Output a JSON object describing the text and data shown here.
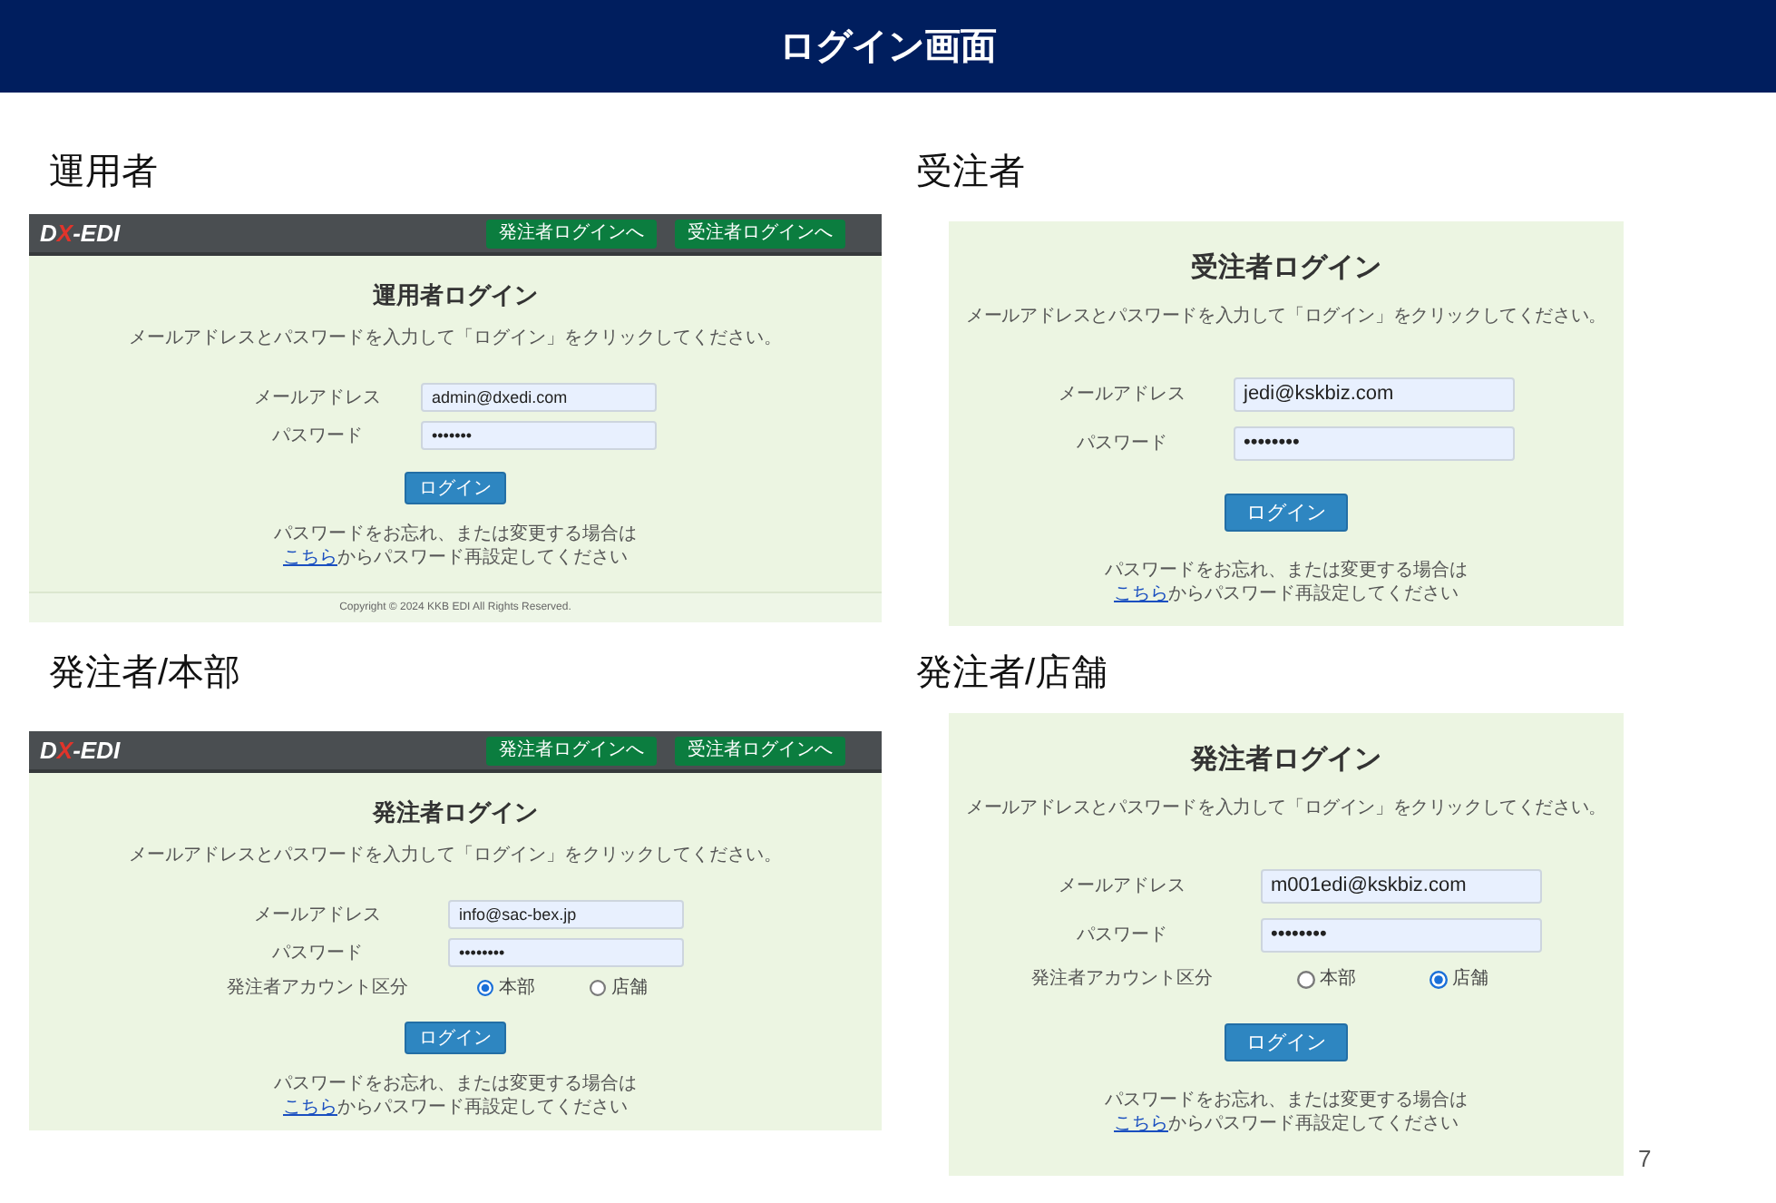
{
  "header": {
    "title": "ログイン画面"
  },
  "sections": [
    {
      "label": "運用者",
      "screenshot": {
        "navbar": {
          "logo": [
            {
              "text": "D",
              "color": "#ffffff"
            },
            {
              "text": "X",
              "color": "#e0342b"
            },
            {
              "text": "-EDI",
              "color": "#ffffff"
            }
          ],
          "buttons": [
            "発注者ログインへ",
            "受注者ログインへ"
          ]
        },
        "form": {
          "title": "運用者ログイン",
          "instruction": "メールアドレスとパスワードを入力して「ログイン」をクリックしてください。",
          "fields": [
            {
              "kind": "input",
              "label": "メールアドレス",
              "value": "admin@dxedi.com"
            },
            {
              "kind": "input",
              "label": "パスワード",
              "value": "•••••••"
            }
          ],
          "button": "ログイン",
          "help": {
            "text": "パスワードをお忘れ、または変更する場合は",
            "link": "こちら",
            "after_link": "からパスワード再設定してください"
          }
        },
        "footer": {
          "text": "Copyright © 2024 KKB EDI All Rights Reserved."
        }
      }
    },
    {
      "label": "受注者",
      "screenshot": {
        "form": {
          "title": "受注者ログイン",
          "instruction": "メールアドレスとパスワードを入力して「ログイン」をクリックしてください。",
          "fields": [
            {
              "kind": "input",
              "label": "メールアドレス",
              "value": "jedi@kskbiz.com"
            },
            {
              "kind": "input",
              "label": "パスワード",
              "value": "••••••••"
            }
          ],
          "button": "ログイン",
          "help": {
            "text": "パスワードをお忘れ、または変更する場合は",
            "link": "こちら",
            "after_link": "からパスワード再設定してください"
          }
        }
      }
    },
    {
      "label": "発注者/本部",
      "screenshot": {
        "navbar": {
          "logo": [
            {
              "text": "D",
              "color": "#ffffff"
            },
            {
              "text": "X",
              "color": "#e0342b"
            },
            {
              "text": "-EDI",
              "color": "#ffffff"
            }
          ],
          "buttons": [
            "発注者ログインへ",
            "受注者ログインへ"
          ]
        },
        "form": {
          "title": "発注者ログイン",
          "instruction": "メールアドレスとパスワードを入力して「ログイン」をクリックしてください。",
          "fields": [
            {
              "kind": "input",
              "label": "メールアドレス",
              "value": "info@sac-bex.jp"
            },
            {
              "kind": "input",
              "label": "パスワード",
              "value": "••••••••"
            },
            {
              "kind": "radio",
              "label": "発注者アカウント区分",
              "options": [
                {
                  "label": "本部",
                  "selected": true
                },
                {
                  "label": "店舗",
                  "selected": false
                }
              ]
            }
          ],
          "button": "ログイン",
          "help": {
            "text": "パスワードをお忘れ、または変更する場合は",
            "link": "こちら",
            "after_link": "からパスワード再設定してください"
          }
        }
      }
    },
    {
      "label": "発注者/店舗",
      "screenshot": {
        "form": {
          "title": "発注者ログイン",
          "instruction": "メールアドレスとパスワードを入力して「ログイン」をクリックしてください。",
          "fields": [
            {
              "kind": "input",
              "label": "メールアドレス",
              "value": "m001edi@kskbiz.com"
            },
            {
              "kind": "input",
              "label": "パスワード",
              "value": "••••••••"
            },
            {
              "kind": "radio",
              "label": "発注者アカウント区分",
              "options": [
                {
                  "label": "本部",
                  "selected": false
                },
                {
                  "label": "店舗",
                  "selected": true
                }
              ]
            }
          ],
          "button": "ログイン",
          "help": {
            "text": "パスワードをお忘れ、または変更する場合は",
            "link": "こちら",
            "after_link": "からパスワード再設定してください"
          }
        }
      }
    }
  ],
  "page_number": "7"
}
